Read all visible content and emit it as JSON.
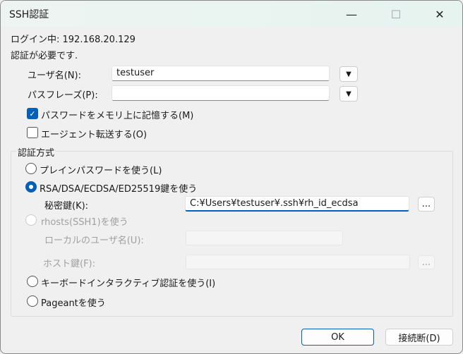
{
  "window": {
    "title": "SSH認証"
  },
  "status": {
    "login_label": "ログイン中: 192.168.20.129",
    "auth_required": "認証が必要です."
  },
  "form": {
    "username_label": "ユーザ名(N):",
    "username_value": "testuser",
    "passphrase_label": "パスフレーズ(P):",
    "passphrase_value": "",
    "remember_password_label": "パスワードをメモリ上に記憶する(M)",
    "remember_password_checked": true,
    "agent_forward_label": "エージェント転送する(O)",
    "agent_forward_checked": false
  },
  "auth_method": {
    "legend": "認証方式",
    "plain_label": "プレインパスワードを使う(L)",
    "rsa_label": "RSA/DSA/ECDSA/ED25519鍵を使う",
    "private_key_label": "秘密鍵(K):",
    "private_key_value": "C:¥Users¥testuser¥.ssh¥rh_id_ecdsa",
    "rhosts_label": "rhosts(SSH1)を使う",
    "local_user_label": "ローカルのユーザ名(U):",
    "host_key_label": "ホスト鍵(F):",
    "keyboard_label": "キーボードインタラクティブ認証を使う(I)",
    "pageant_label": "Pageantを使う",
    "selected": "rsa",
    "browse_label": "..."
  },
  "buttons": {
    "ok": "OK",
    "disconnect": "接続断(D)"
  },
  "icons": {
    "minimize": "—",
    "maximize": "☐",
    "close": "✕",
    "dropdown": "▼",
    "check": "✓"
  }
}
